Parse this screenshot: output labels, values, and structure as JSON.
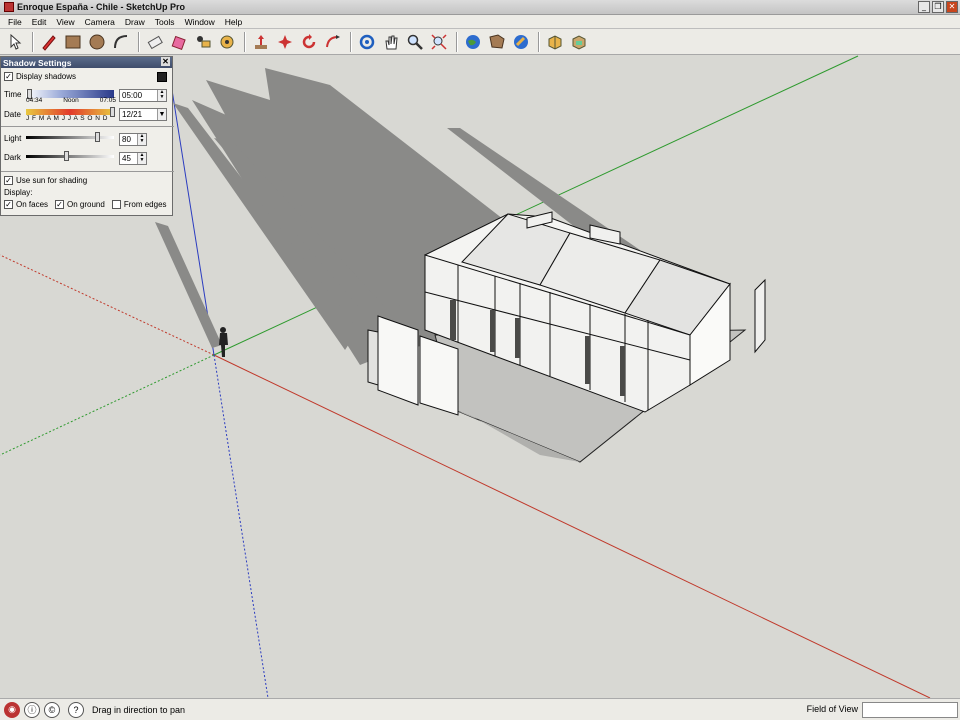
{
  "window": {
    "title": "Enroque España - Chile - SketchUp Pro"
  },
  "menu": {
    "items": [
      "File",
      "Edit",
      "View",
      "Camera",
      "Draw",
      "Tools",
      "Window",
      "Help"
    ]
  },
  "toolbar": {
    "tools": [
      "select-icon",
      "pencil-icon",
      "rectangle-icon",
      "circle-icon",
      "arc-icon",
      "eraser-icon",
      "paint-bucket-icon",
      "push-pull-icon",
      "tape-measure-icon",
      "move-icon",
      "rotate-icon",
      "follow-me-icon",
      "orbit-icon",
      "pan-icon",
      "zoom-icon",
      "zoom-extents-icon",
      "get-models-icon",
      "share-model-icon",
      "google-earth-icon",
      "components-icon",
      "photo-textures-icon"
    ]
  },
  "shadow_settings": {
    "title": "Shadow Settings",
    "display_shadows_label": "Display shadows",
    "display_shadows": true,
    "time_label": "Time",
    "time_start": "04:34",
    "time_mid": "Noon",
    "time_end": "07:05",
    "time_value": "05:00",
    "date_label": "Date",
    "months": "J F M A M J J A S O N D",
    "date_value": "12/21",
    "light_label": "Light",
    "light_value": "80",
    "dark_label": "Dark",
    "dark_value": "45",
    "use_sun_label": "Use sun for shading",
    "use_sun": true,
    "display_label": "Display:",
    "on_faces_label": "On faces",
    "on_faces": true,
    "on_ground_label": "On ground",
    "on_ground": true,
    "from_edges_label": "From edges",
    "from_edges": false
  },
  "status": {
    "message": "Drag in direction to pan",
    "measurement_label": "Field of View",
    "measurement_value": ""
  },
  "colors": {
    "axis_red": "#c0392b",
    "axis_green": "#2e9a2e",
    "axis_blue": "#2b3cc0",
    "ground": "#d8d8d3",
    "shadow": "#8a8a88"
  }
}
